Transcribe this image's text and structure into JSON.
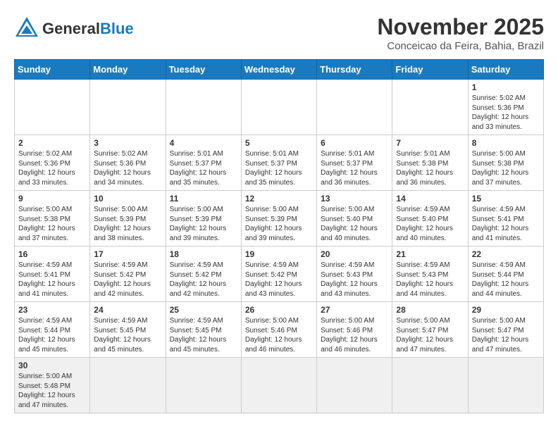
{
  "header": {
    "logo_general": "General",
    "logo_blue": "Blue",
    "month_title": "November 2025",
    "location": "Conceicao da Feira, Bahia, Brazil"
  },
  "days_of_week": [
    "Sunday",
    "Monday",
    "Tuesday",
    "Wednesday",
    "Thursday",
    "Friday",
    "Saturday"
  ],
  "weeks": [
    [
      {
        "day": "",
        "info": ""
      },
      {
        "day": "",
        "info": ""
      },
      {
        "day": "",
        "info": ""
      },
      {
        "day": "",
        "info": ""
      },
      {
        "day": "",
        "info": ""
      },
      {
        "day": "",
        "info": ""
      },
      {
        "day": "1",
        "info": "Sunrise: 5:02 AM\nSunset: 5:36 PM\nDaylight: 12 hours and 33 minutes."
      }
    ],
    [
      {
        "day": "2",
        "info": "Sunrise: 5:02 AM\nSunset: 5:36 PM\nDaylight: 12 hours and 33 minutes."
      },
      {
        "day": "3",
        "info": "Sunrise: 5:02 AM\nSunset: 5:36 PM\nDaylight: 12 hours and 34 minutes."
      },
      {
        "day": "4",
        "info": "Sunrise: 5:01 AM\nSunset: 5:37 PM\nDaylight: 12 hours and 35 minutes."
      },
      {
        "day": "5",
        "info": "Sunrise: 5:01 AM\nSunset: 5:37 PM\nDaylight: 12 hours and 35 minutes."
      },
      {
        "day": "6",
        "info": "Sunrise: 5:01 AM\nSunset: 5:37 PM\nDaylight: 12 hours and 36 minutes."
      },
      {
        "day": "7",
        "info": "Sunrise: 5:01 AM\nSunset: 5:38 PM\nDaylight: 12 hours and 36 minutes."
      },
      {
        "day": "8",
        "info": "Sunrise: 5:00 AM\nSunset: 5:38 PM\nDaylight: 12 hours and 37 minutes."
      }
    ],
    [
      {
        "day": "9",
        "info": "Sunrise: 5:00 AM\nSunset: 5:38 PM\nDaylight: 12 hours and 37 minutes."
      },
      {
        "day": "10",
        "info": "Sunrise: 5:00 AM\nSunset: 5:39 PM\nDaylight: 12 hours and 38 minutes."
      },
      {
        "day": "11",
        "info": "Sunrise: 5:00 AM\nSunset: 5:39 PM\nDaylight: 12 hours and 39 minutes."
      },
      {
        "day": "12",
        "info": "Sunrise: 5:00 AM\nSunset: 5:39 PM\nDaylight: 12 hours and 39 minutes."
      },
      {
        "day": "13",
        "info": "Sunrise: 5:00 AM\nSunset: 5:40 PM\nDaylight: 12 hours and 40 minutes."
      },
      {
        "day": "14",
        "info": "Sunrise: 4:59 AM\nSunset: 5:40 PM\nDaylight: 12 hours and 40 minutes."
      },
      {
        "day": "15",
        "info": "Sunrise: 4:59 AM\nSunset: 5:41 PM\nDaylight: 12 hours and 41 minutes."
      }
    ],
    [
      {
        "day": "16",
        "info": "Sunrise: 4:59 AM\nSunset: 5:41 PM\nDaylight: 12 hours and 41 minutes."
      },
      {
        "day": "17",
        "info": "Sunrise: 4:59 AM\nSunset: 5:42 PM\nDaylight: 12 hours and 42 minutes."
      },
      {
        "day": "18",
        "info": "Sunrise: 4:59 AM\nSunset: 5:42 PM\nDaylight: 12 hours and 42 minutes."
      },
      {
        "day": "19",
        "info": "Sunrise: 4:59 AM\nSunset: 5:42 PM\nDaylight: 12 hours and 43 minutes."
      },
      {
        "day": "20",
        "info": "Sunrise: 4:59 AM\nSunset: 5:43 PM\nDaylight: 12 hours and 43 minutes."
      },
      {
        "day": "21",
        "info": "Sunrise: 4:59 AM\nSunset: 5:43 PM\nDaylight: 12 hours and 44 minutes."
      },
      {
        "day": "22",
        "info": "Sunrise: 4:59 AM\nSunset: 5:44 PM\nDaylight: 12 hours and 44 minutes."
      }
    ],
    [
      {
        "day": "23",
        "info": "Sunrise: 4:59 AM\nSunset: 5:44 PM\nDaylight: 12 hours and 45 minutes."
      },
      {
        "day": "24",
        "info": "Sunrise: 4:59 AM\nSunset: 5:45 PM\nDaylight: 12 hours and 45 minutes."
      },
      {
        "day": "25",
        "info": "Sunrise: 4:59 AM\nSunset: 5:45 PM\nDaylight: 12 hours and 45 minutes."
      },
      {
        "day": "26",
        "info": "Sunrise: 5:00 AM\nSunset: 5:46 PM\nDaylight: 12 hours and 46 minutes."
      },
      {
        "day": "27",
        "info": "Sunrise: 5:00 AM\nSunset: 5:46 PM\nDaylight: 12 hours and 46 minutes."
      },
      {
        "day": "28",
        "info": "Sunrise: 5:00 AM\nSunset: 5:47 PM\nDaylight: 12 hours and 47 minutes."
      },
      {
        "day": "29",
        "info": "Sunrise: 5:00 AM\nSunset: 5:47 PM\nDaylight: 12 hours and 47 minutes."
      }
    ],
    [
      {
        "day": "30",
        "info": "Sunrise: 5:00 AM\nSunset: 5:48 PM\nDaylight: 12 hours and 47 minutes."
      },
      {
        "day": "",
        "info": ""
      },
      {
        "day": "",
        "info": ""
      },
      {
        "day": "",
        "info": ""
      },
      {
        "day": "",
        "info": ""
      },
      {
        "day": "",
        "info": ""
      },
      {
        "day": "",
        "info": ""
      }
    ]
  ]
}
